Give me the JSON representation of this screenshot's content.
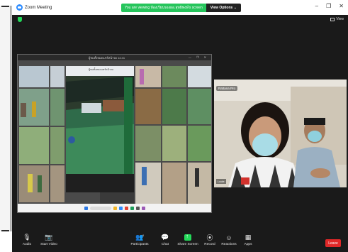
{
  "app": {
    "title": "Zoom Meeting"
  },
  "banner": {
    "message": "You are viewing ห้องเรียนรองผอ.สุทธิพงษ์'s screen",
    "view_options": "View Options",
    "view_options_caret": "⌄"
  },
  "window_controls": [
    "–",
    "❐",
    "✕"
  ],
  "meeting": {
    "view_label": "View"
  },
  "shared_screen": {
    "window_title": "ผู้ชมทั้งหมดแชร์หน้าจอ 14:41",
    "inner_title": "ผู้ชมทั้งหมดแชร์หน้าจอ",
    "controls": "— ❐ ✕"
  },
  "participant": {
    "name_tag": "Rattana Pro",
    "sub_tag": "Lucie"
  },
  "toolbar": {
    "items": [
      {
        "key": "audio",
        "label": "Audio",
        "icon": "microphone-icon",
        "glyph": "🎙"
      },
      {
        "key": "video",
        "label": "Start Video",
        "icon": "video-camera-icon",
        "glyph": "📷"
      },
      {
        "key": "participants",
        "label": "Participants",
        "icon": "participants-icon",
        "glyph": "👥",
        "count": "6"
      },
      {
        "key": "chat",
        "label": "Chat",
        "icon": "chat-icon",
        "glyph": "💬"
      },
      {
        "key": "share",
        "label": "Share Screen",
        "icon": "share-screen-icon",
        "glyph": ""
      },
      {
        "key": "record",
        "label": "Record",
        "icon": "record-icon",
        "glyph": "⦿"
      },
      {
        "key": "reactions",
        "label": "Reactions",
        "icon": "reactions-icon",
        "glyph": "☺"
      },
      {
        "key": "apps",
        "label": "Apps",
        "icon": "apps-icon",
        "glyph": "▦"
      }
    ],
    "leave_label": "Leave"
  },
  "colors": {
    "accent_green": "#26c55c",
    "leave_red": "#e02828",
    "zoom_blue": "#2d8cff",
    "meeting_bg": "#1a1a1a"
  }
}
